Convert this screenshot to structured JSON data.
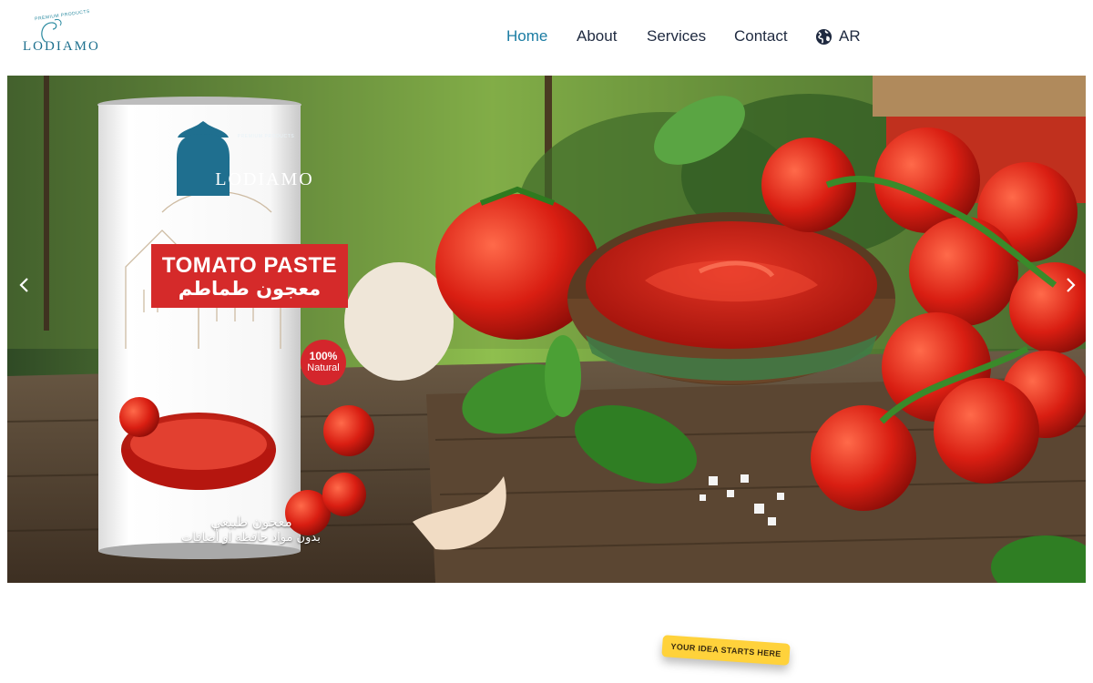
{
  "brand": {
    "logo_tagline": "PREMIUM PRODUCTS",
    "logo_wordmark": "LODIAMO",
    "colors": {
      "brand_teal": "#1c6f8d",
      "nav_active": "#1b7ca3",
      "tag_yellow": "#ffd23b"
    }
  },
  "nav": {
    "items": [
      {
        "label": "Home",
        "active": true
      },
      {
        "label": "About"
      },
      {
        "label": "Services"
      },
      {
        "label": "Contact"
      }
    ],
    "language": {
      "icon": "globe-icon",
      "label": "AR"
    }
  },
  "hero": {
    "carousel": {
      "prev_icon": "chevron-left-icon",
      "next_icon": "chevron-right-icon"
    },
    "product": {
      "premium_label": "PREMIUM PRODUCTS",
      "brand": "LODIAMO",
      "title": "TOMATO PASTE",
      "title_ar": "معجون طماطم",
      "badge_percent": "100%",
      "badge_text": "Natural",
      "tagline_ar_1": "معجون طبيعي",
      "tagline_ar_2": "بدون مواد حافظة او أضافات"
    }
  },
  "section": {
    "tag": "YOUR IDEA STARTS HERE"
  }
}
